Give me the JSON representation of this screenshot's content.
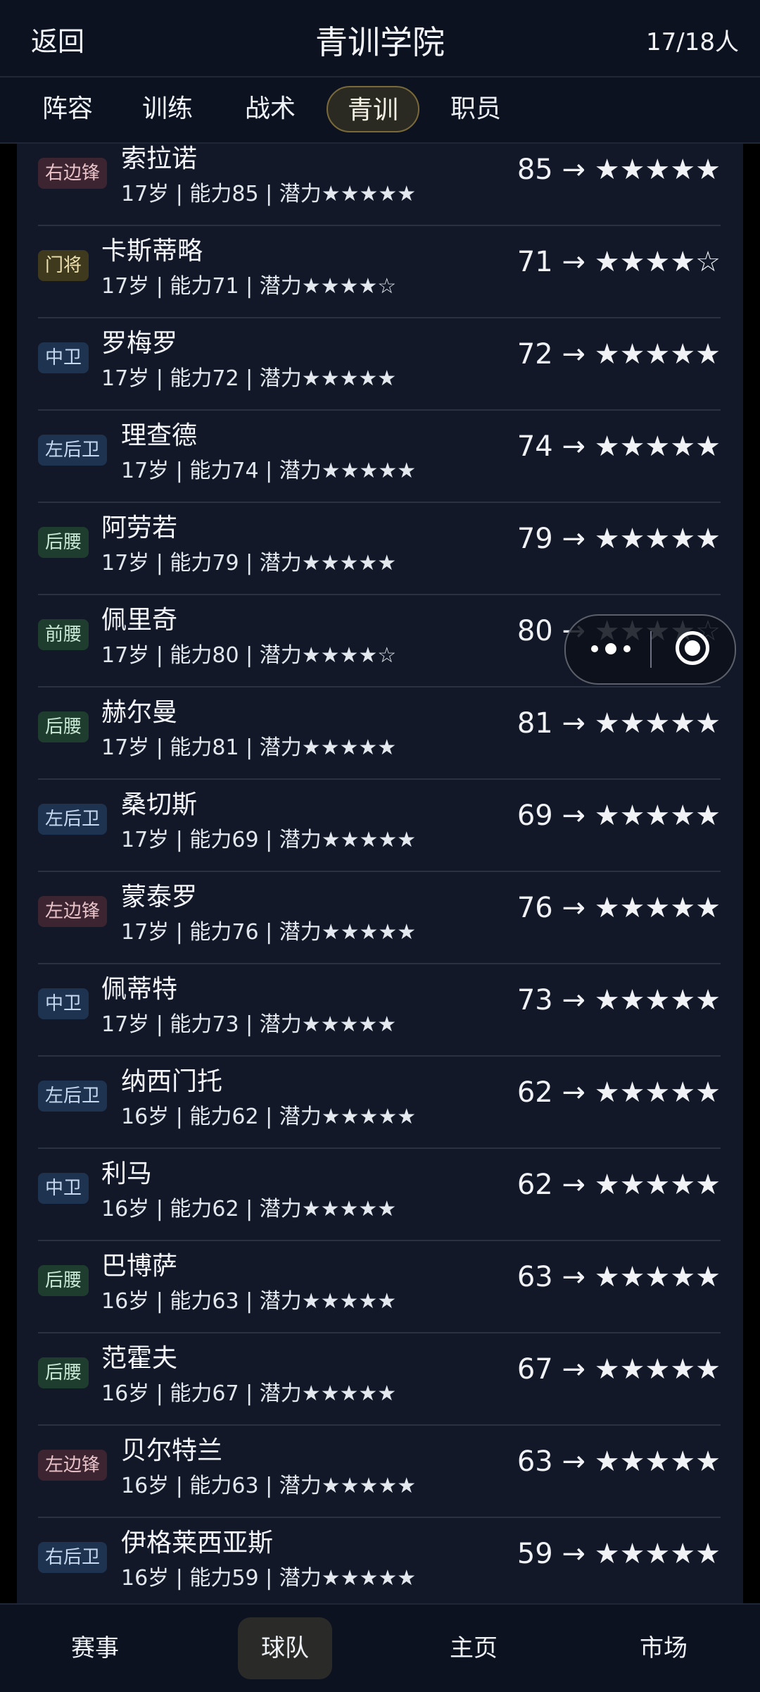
{
  "header": {
    "back_label": "返回",
    "title": "青训学院",
    "count": "17/18人"
  },
  "tabs": [
    {
      "label": "阵容"
    },
    {
      "label": "训练"
    },
    {
      "label": "战术"
    },
    {
      "label": "青训",
      "active": true
    },
    {
      "label": "职员"
    }
  ],
  "players": [
    {
      "position": "右边锋",
      "name": "索拉诺",
      "info": "17岁 | 能力85 | 潜力★★★★★",
      "rating": "85 → ★★★★★"
    },
    {
      "position": "门将",
      "name": "卡斯蒂略",
      "info": "17岁 | 能力71 | 潜力★★★★☆",
      "rating": "71 → ★★★★☆"
    },
    {
      "position": "中卫",
      "name": "罗梅罗",
      "info": "17岁 | 能力72 | 潜力★★★★★",
      "rating": "72 → ★★★★★"
    },
    {
      "position": "左后卫",
      "name": "理查德",
      "info": "17岁 | 能力74 | 潜力★★★★★",
      "rating": "74 → ★★★★★"
    },
    {
      "position": "后腰",
      "name": "阿劳若",
      "info": "17岁 | 能力79 | 潜力★★★★★",
      "rating": "79 → ★★★★★"
    },
    {
      "position": "前腰",
      "name": "佩里奇",
      "info": "17岁 | 能力80 | 潜力★★★★☆",
      "rating": "80 → ★★★★☆"
    },
    {
      "position": "后腰",
      "name": "赫尔曼",
      "info": "17岁 | 能力81 | 潜力★★★★★",
      "rating": "81 → ★★★★★"
    },
    {
      "position": "左后卫",
      "name": "桑切斯",
      "info": "17岁 | 能力69 | 潜力★★★★★",
      "rating": "69 → ★★★★★"
    },
    {
      "position": "左边锋",
      "name": "蒙泰罗",
      "info": "17岁 | 能力76 | 潜力★★★★★",
      "rating": "76 → ★★★★★"
    },
    {
      "position": "中卫",
      "name": "佩蒂特",
      "info": "17岁 | 能力73 | 潜力★★★★★",
      "rating": "73 → ★★★★★"
    },
    {
      "position": "左后卫",
      "name": "纳西门托",
      "info": "16岁 | 能力62 | 潜力★★★★★",
      "rating": "62 → ★★★★★"
    },
    {
      "position": "中卫",
      "name": "利马",
      "info": "16岁 | 能力62 | 潜力★★★★★",
      "rating": "62 → ★★★★★"
    },
    {
      "position": "后腰",
      "name": "巴博萨",
      "info": "16岁 | 能力63 | 潜力★★★★★",
      "rating": "63 → ★★★★★"
    },
    {
      "position": "后腰",
      "name": "范霍夫",
      "info": "16岁 | 能力67 | 潜力★★★★★",
      "rating": "67 → ★★★★★"
    },
    {
      "position": "左边锋",
      "name": "贝尔特兰",
      "info": "16岁 | 能力63 | 潜力★★★★★",
      "rating": "63 → ★★★★★"
    },
    {
      "position": "右后卫",
      "name": "伊格莱西亚斯",
      "info": "16岁 | 能力59 | 潜力★★★★★",
      "rating": "59 → ★★★★★"
    }
  ],
  "bottom_nav": [
    {
      "label": "赛事"
    },
    {
      "label": "球队",
      "active": true
    },
    {
      "label": "主页"
    },
    {
      "label": "市场"
    }
  ],
  "capsule": {
    "more_icon": "more-dots-icon",
    "close_icon": "close-target-icon"
  },
  "colors": {
    "background": "#121827",
    "header": "#0c1220",
    "active_tab_border": "#7a6a3a"
  }
}
